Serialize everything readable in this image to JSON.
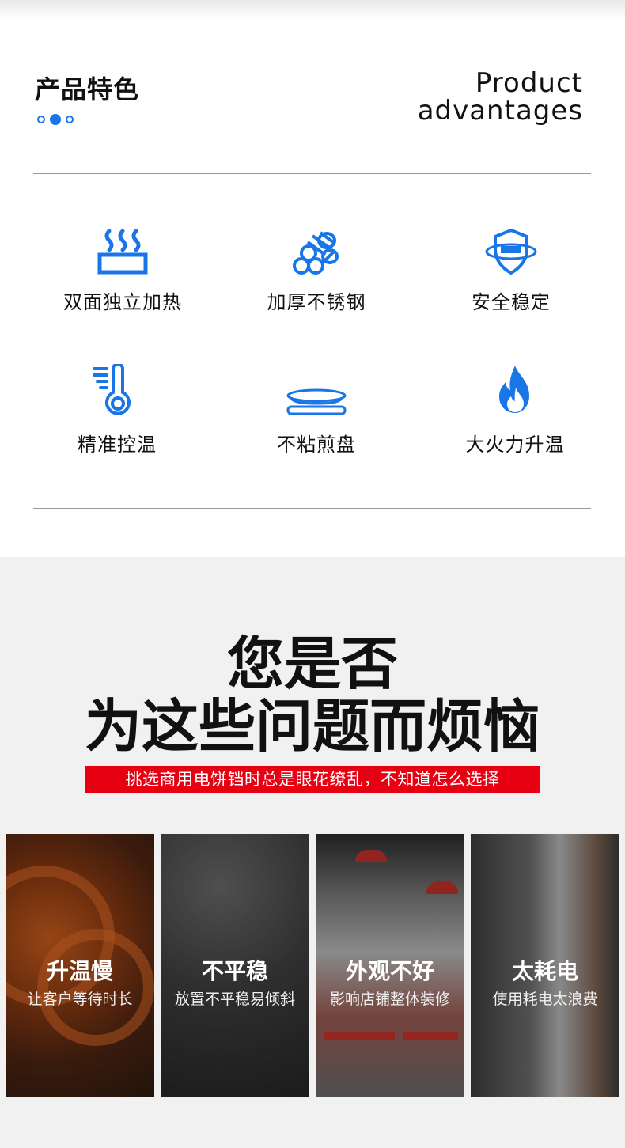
{
  "header": {
    "title_cn": "产品特色",
    "title_en_line1": "Product",
    "title_en_line2": "advantages",
    "accent_color": "#1976e8"
  },
  "features": [
    {
      "label": "双面独立加热",
      "icon": "steam-heat-icon"
    },
    {
      "label": "加厚不锈钢",
      "icon": "steel-pipes-icon"
    },
    {
      "label": "安全稳定",
      "icon": "shield-icon"
    },
    {
      "label": "精准控温",
      "icon": "thermometer-icon"
    },
    {
      "label": "不粘煎盘",
      "icon": "pan-icon"
    },
    {
      "label": "大火力升温",
      "icon": "flame-icon"
    }
  ],
  "problems": {
    "headline_line1": "您是否",
    "headline_line2": "为这些问题而烦恼",
    "subtitle": "挑选商用电饼铛时总是眼花缭乱，不知道怎么选择",
    "subtitle_bg": "#e60012",
    "cards": [
      {
        "title": "升温慢",
        "desc": "让客户等待时长"
      },
      {
        "title": "不平稳",
        "desc": "放置不平稳易倾斜"
      },
      {
        "title": "外观不好",
        "desc": "影响店铺整体装修"
      },
      {
        "title": "太耗电",
        "desc": "使用耗电太浪费"
      }
    ]
  }
}
